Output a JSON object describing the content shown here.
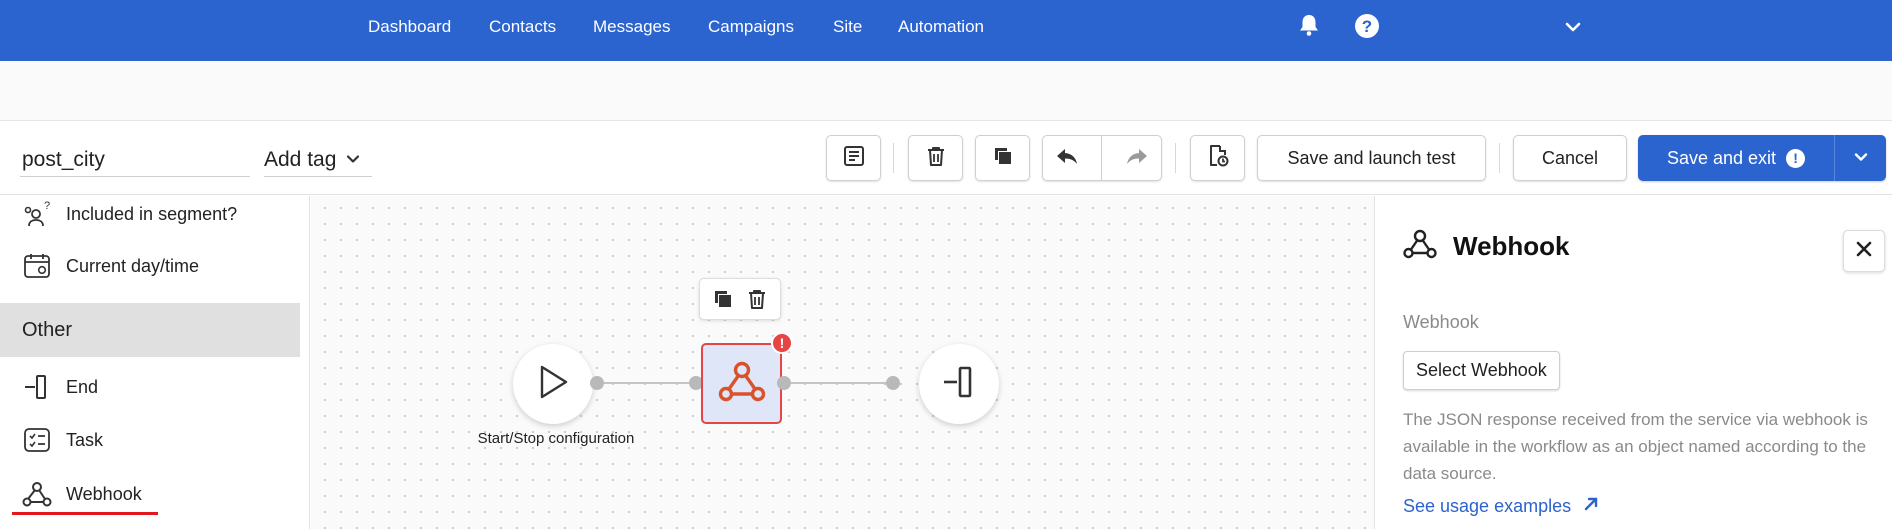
{
  "nav": {
    "links": [
      "Dashboard",
      "Contacts",
      "Messages",
      "Campaigns",
      "Site",
      "Automation"
    ],
    "icons": [
      "bell-icon",
      "help-icon",
      "chevron-down-icon"
    ]
  },
  "toolbar": {
    "name_value": "post_city",
    "tag_label": "Add tag",
    "save_launch_label": "Save and launch test",
    "cancel_label": "Cancel",
    "save_exit_label": "Save and exit",
    "save_exit_warning": "!"
  },
  "palette": {
    "items_top": [
      {
        "label": "Included in segment?",
        "icon": "segment-question-icon"
      },
      {
        "label": "Current day/time",
        "icon": "calendar-clock-icon"
      }
    ],
    "section": "Other",
    "items_other": [
      {
        "label": "End",
        "icon": "end-icon"
      },
      {
        "label": "Task",
        "icon": "task-icon"
      },
      {
        "label": "Webhook",
        "icon": "webhook-icon"
      }
    ]
  },
  "canvas": {
    "start_label": "Start/Stop configuration",
    "webhook_badge": "!"
  },
  "panel": {
    "title": "Webhook",
    "field_label": "Webhook",
    "select_button": "Select Webhook",
    "description": "The JSON response received from the service via webhook is available in the workflow as an object named according to the data source.",
    "link": "See usage examples"
  },
  "colors": {
    "brand": "#2b63cf",
    "error": "#e64545",
    "webhook_icon": "#d9522b",
    "highlight_underline": "#e3181c"
  }
}
